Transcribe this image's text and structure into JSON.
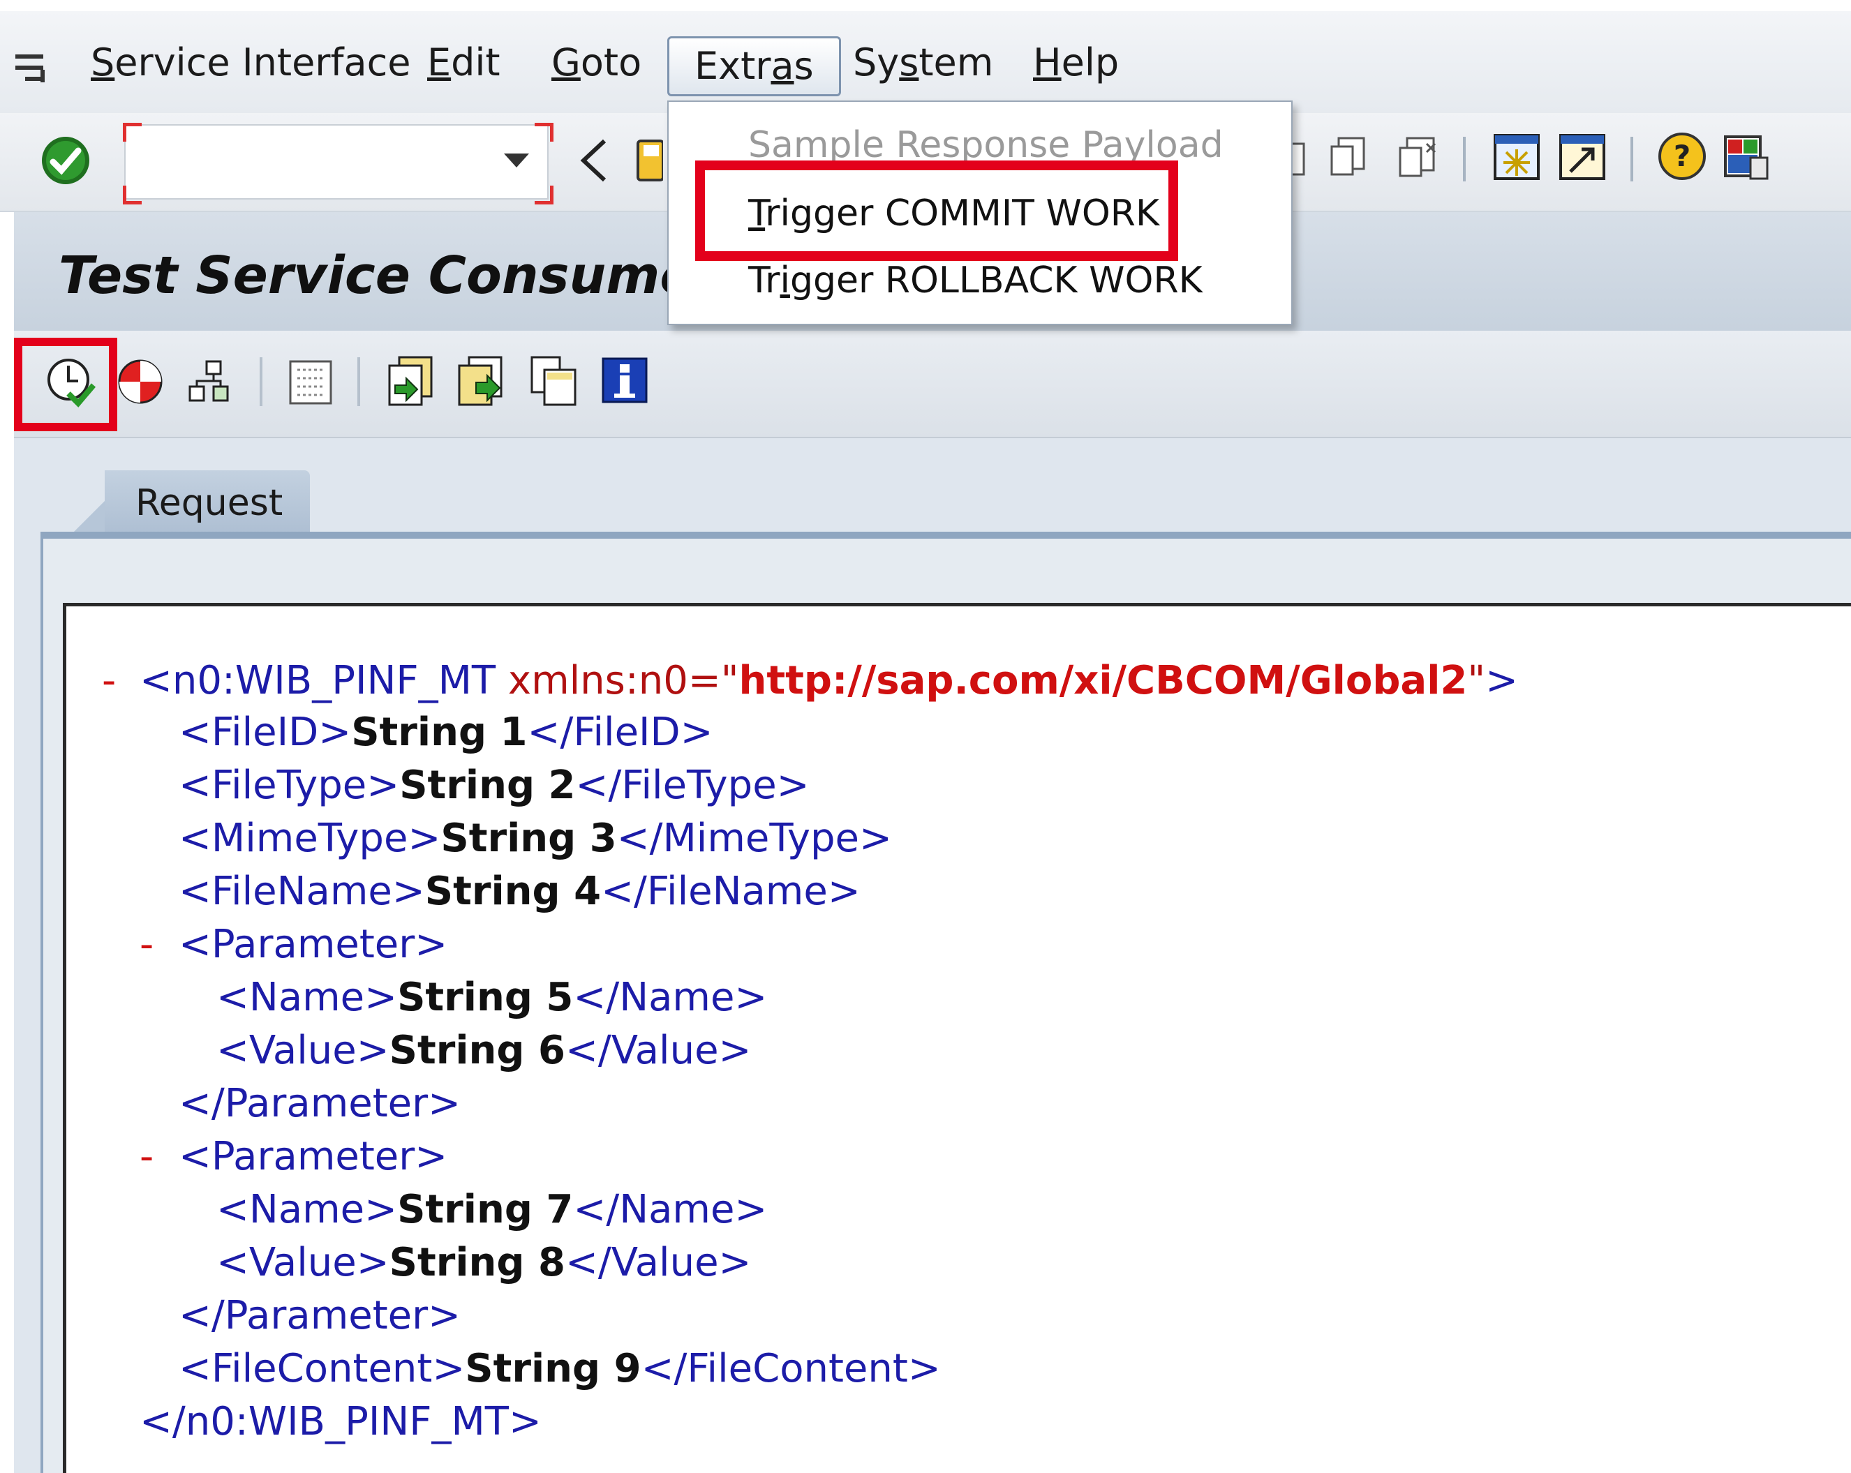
{
  "menubar": {
    "items": [
      {
        "pre": "",
        "acc": "S",
        "post": "ervice Interface"
      },
      {
        "pre": "",
        "acc": "E",
        "post": "dit"
      },
      {
        "pre": "",
        "acc": "G",
        "post": "oto"
      },
      {
        "pre": "Extr",
        "acc": "a",
        "post": "s"
      },
      {
        "pre": "Sy",
        "acc": "s",
        "post": "tem"
      },
      {
        "pre": "",
        "acc": "H",
        "post": "elp"
      }
    ],
    "open_menu": "Extras"
  },
  "extras_menu": {
    "items": [
      {
        "pre": "Sample Response Payload",
        "acc": "",
        "post": "",
        "enabled": false
      },
      {
        "pre": "",
        "acc": "T",
        "post": "rigger COMMIT WORK",
        "enabled": true,
        "highlighted": true
      },
      {
        "pre": "Tr",
        "acc": "i",
        "post": "gger ROLLBACK WORK",
        "enabled": true
      }
    ]
  },
  "toolbar": {
    "command_field_value": ""
  },
  "page": {
    "title": "Test Service Consumer:"
  },
  "app_toolbar": {
    "highlighted_icon": "execute-icon"
  },
  "tabs": [
    {
      "label": "Request",
      "active": true
    }
  ],
  "xml": {
    "lines": [
      {
        "toggle": "-",
        "open": "<",
        "tag": "n0:WIB_PINF_MT",
        "attr": " xmlns:n0=\"",
        "aval": "http://sap.com/xi/CBCOM/Global2",
        "attr_end": "\"",
        "close": ">",
        "value": "",
        "end_open": "",
        "end_tag": "",
        "end_close": ""
      },
      {
        "toggle": "",
        "open": "<",
        "tag": "FileID",
        "attr": "",
        "aval": "",
        "attr_end": "",
        "close": ">",
        "value": "String 1",
        "end_open": "</",
        "end_tag": "FileID",
        "end_close": ">"
      },
      {
        "toggle": "",
        "open": "<",
        "tag": "FileType",
        "attr": "",
        "aval": "",
        "attr_end": "",
        "close": ">",
        "value": "String 2",
        "end_open": "</",
        "end_tag": "FileType",
        "end_close": ">"
      },
      {
        "toggle": "",
        "open": "<",
        "tag": "MimeType",
        "attr": "",
        "aval": "",
        "attr_end": "",
        "close": ">",
        "value": "String 3",
        "end_open": "</",
        "end_tag": "MimeType",
        "end_close": ">"
      },
      {
        "toggle": "",
        "open": "<",
        "tag": "FileName",
        "attr": "",
        "aval": "",
        "attr_end": "",
        "close": ">",
        "value": "String 4",
        "end_open": "</",
        "end_tag": "FileName",
        "end_close": ">"
      },
      {
        "toggle": "-",
        "open": "<",
        "tag": "Parameter",
        "attr": "",
        "aval": "",
        "attr_end": "",
        "close": ">",
        "value": "",
        "end_open": "",
        "end_tag": "",
        "end_close": ""
      },
      {
        "toggle": "",
        "open": "<",
        "tag": "Name",
        "attr": "",
        "aval": "",
        "attr_end": "",
        "close": ">",
        "value": "String 5",
        "end_open": "</",
        "end_tag": "Name",
        "end_close": ">"
      },
      {
        "toggle": "",
        "open": "<",
        "tag": "Value",
        "attr": "",
        "aval": "",
        "attr_end": "",
        "close": ">",
        "value": "String 6",
        "end_open": "</",
        "end_tag": "Value",
        "end_close": ">"
      },
      {
        "toggle": "",
        "open": "</",
        "tag": "Parameter",
        "attr": "",
        "aval": "",
        "attr_end": "",
        "close": ">",
        "value": "",
        "end_open": "",
        "end_tag": "",
        "end_close": ""
      },
      {
        "toggle": "-",
        "open": "<",
        "tag": "Parameter",
        "attr": "",
        "aval": "",
        "attr_end": "",
        "close": ">",
        "value": "",
        "end_open": "",
        "end_tag": "",
        "end_close": ""
      },
      {
        "toggle": "",
        "open": "<",
        "tag": "Name",
        "attr": "",
        "aval": "",
        "attr_end": "",
        "close": ">",
        "value": "String 7",
        "end_open": "</",
        "end_tag": "Name",
        "end_close": ">"
      },
      {
        "toggle": "",
        "open": "<",
        "tag": "Value",
        "attr": "",
        "aval": "",
        "attr_end": "",
        "close": ">",
        "value": "String 8",
        "end_open": "</",
        "end_tag": "Value",
        "end_close": ">"
      },
      {
        "toggle": "",
        "open": "</",
        "tag": "Parameter",
        "attr": "",
        "aval": "",
        "attr_end": "",
        "close": ">",
        "value": "",
        "end_open": "",
        "end_tag": "",
        "end_close": ""
      },
      {
        "toggle": "",
        "open": "<",
        "tag": "FileContent",
        "attr": "",
        "aval": "",
        "attr_end": "",
        "close": ">",
        "value": "String 9",
        "end_open": "</",
        "end_tag": "FileContent",
        "end_close": ">"
      },
      {
        "toggle": "",
        "open": "</",
        "tag": "n0:WIB_PINF_MT",
        "attr": "",
        "aval": "",
        "attr_end": "",
        "close": ">",
        "value": "",
        "end_open": "",
        "end_tag": "",
        "end_close": ""
      }
    ]
  },
  "colors": {
    "highlight_red": "#e3001b",
    "xml_tag_blue": "#1c1ca8",
    "xml_attr_red": "#b01010"
  },
  "icons": {
    "system_toolbar": [
      "enter-icon",
      "command-dropdown-icon",
      "back-icon",
      "save-icon",
      "find-icon",
      "find-next-icon",
      "create-session-icon",
      "shortcut-icon",
      "help-icon",
      "customize-layout-icon"
    ],
    "app_toolbar": [
      "execute-icon",
      "stop-icon",
      "hierarchy-icon",
      "settings-icon",
      "load-file-icon",
      "save-file-icon",
      "copy-icon",
      "info-icon"
    ]
  }
}
